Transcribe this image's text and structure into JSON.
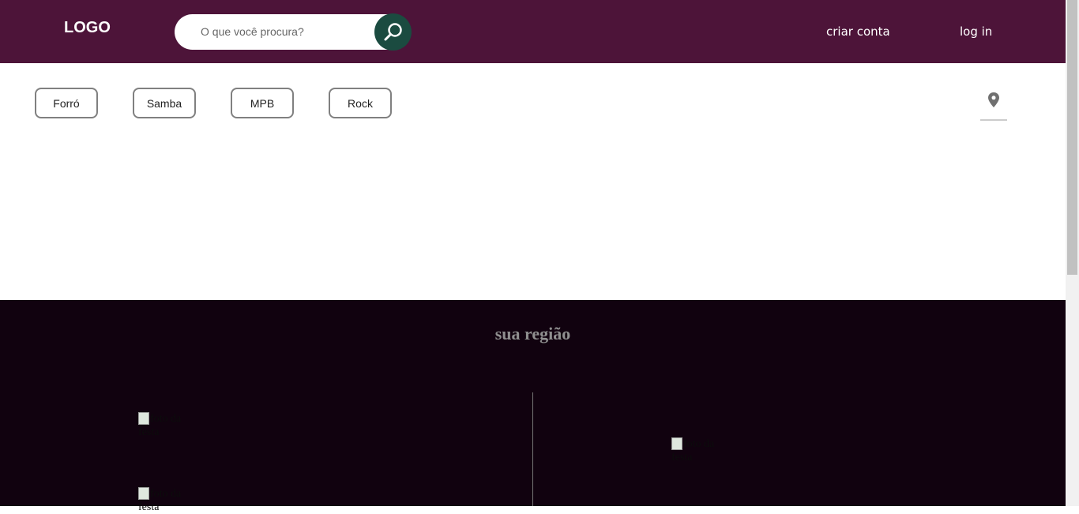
{
  "header": {
    "logo": "LOGO",
    "search_placeholder": "O que você procura?",
    "search_icon": "magnifier-icon",
    "criar_conta": "criar conta",
    "login": "log in"
  },
  "genres": [
    "Forró",
    "Samba",
    "MPB",
    "Rock"
  ],
  "location_icon": "location-pin-icon",
  "region": {
    "title": "sua região",
    "images": [
      {
        "alt": "foto da festa"
      },
      {
        "alt": "foto da festa"
      },
      {
        "alt": "foto da festa"
      }
    ]
  },
  "colors": {
    "header": "#4d1439",
    "search_button": "#1b4b40",
    "region_bg": "#11020f"
  }
}
